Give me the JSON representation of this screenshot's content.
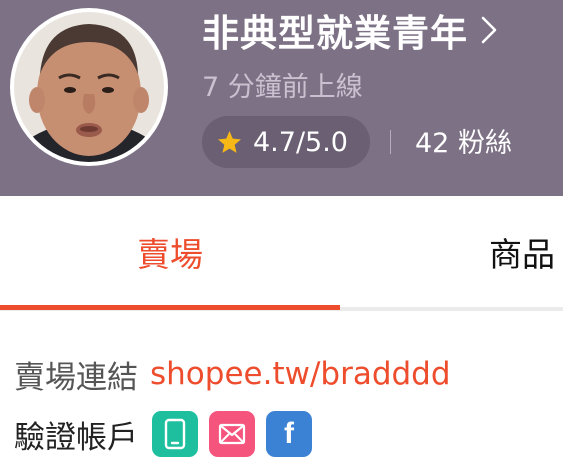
{
  "shop": {
    "name": "非典型就業青年",
    "last_online": "7 分鐘前上線",
    "rating": "4.7/5.0",
    "followers": "42 粉絲"
  },
  "tabs": [
    {
      "label": "賣場",
      "active": true
    },
    {
      "label": "商品",
      "active": false
    }
  ],
  "info": {
    "shop_link_label": "賣場連結",
    "shop_link_url": "shopee.tw/bradddd",
    "verified_label": "驗證帳戶",
    "verified_badges": [
      "phone-icon",
      "email-icon",
      "facebook-icon"
    ]
  },
  "colors": {
    "header_bg": "#7d7185",
    "accent": "#ee4d2d",
    "star": "#f6b817",
    "phone_badge": "#1dbf9e",
    "email_badge": "#f5547d",
    "facebook_badge": "#3b82d4"
  }
}
